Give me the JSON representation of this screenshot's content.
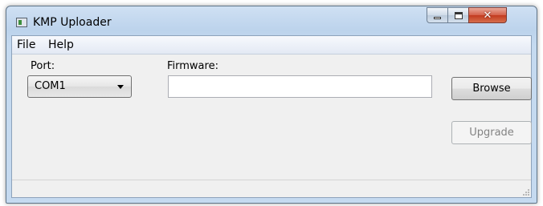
{
  "window": {
    "title": "KMP Uploader",
    "close_glyph": "✕"
  },
  "menu": {
    "items": [
      "File",
      "Help"
    ]
  },
  "form": {
    "port_label": "Port:",
    "port_value": "COM1",
    "firmware_label": "Firmware:",
    "firmware_value": "",
    "browse_label": "Browse",
    "upgrade_label": "Upgrade"
  },
  "icons": {
    "app": "app-icon",
    "minimize": "minimize-icon",
    "maximize": "maximize-icon",
    "close": "close-icon",
    "dropdown": "chevron-down-icon",
    "grip": "resize-grip-icon"
  },
  "colors": {
    "close_button": "#c23a1f",
    "disabled_text": "#838383"
  }
}
